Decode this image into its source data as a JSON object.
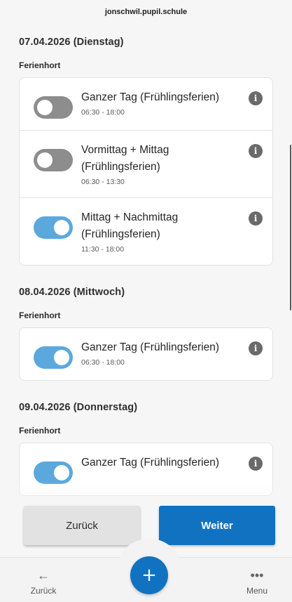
{
  "browser": {
    "url": "jonschwil.pupil.schule"
  },
  "days": [
    {
      "title": "07.04.2026 (Dienstag)",
      "group": "Ferienhort",
      "options": [
        {
          "name_line1": "Ganzer Tag (Frühlingsferien)",
          "name_line2": "",
          "time": "06:30 - 18:00",
          "on": false
        },
        {
          "name_line1": "Vormittag + Mittag",
          "name_line2": "(Frühlingsferien)",
          "time": "06:30 - 13:30",
          "on": false
        },
        {
          "name_line1": "Mittag + Nachmittag",
          "name_line2": "(Frühlingsferien)",
          "time": "11:30 - 18:00",
          "on": true
        }
      ]
    },
    {
      "title": "08.04.2026 (Mittwoch)",
      "group": "Ferienhort",
      "options": [
        {
          "name_line1": "Ganzer Tag (Frühlingsferien)",
          "name_line2": "",
          "time": "06:30 - 18:00",
          "on": true
        }
      ]
    },
    {
      "title": "09.04.2026 (Donnerstag)",
      "group": "Ferienhort",
      "options": [
        {
          "name_line1": "Ganzer Tag (Frühlingsferien)",
          "name_line2": "",
          "time": "",
          "on": true
        }
      ]
    }
  ],
  "info_icon": "info-icon",
  "actions": {
    "back_label": "Zurück",
    "next_label": "Weiter"
  },
  "tabbar": {
    "back_label": "Zurück",
    "back_icon": "←",
    "menu_label": "Menu",
    "menu_icon": "•••",
    "add_icon": "+"
  },
  "colors": {
    "primary": "#1172c2",
    "toggle_on": "#5ba8dd",
    "toggle_off": "#8d8d8d"
  }
}
